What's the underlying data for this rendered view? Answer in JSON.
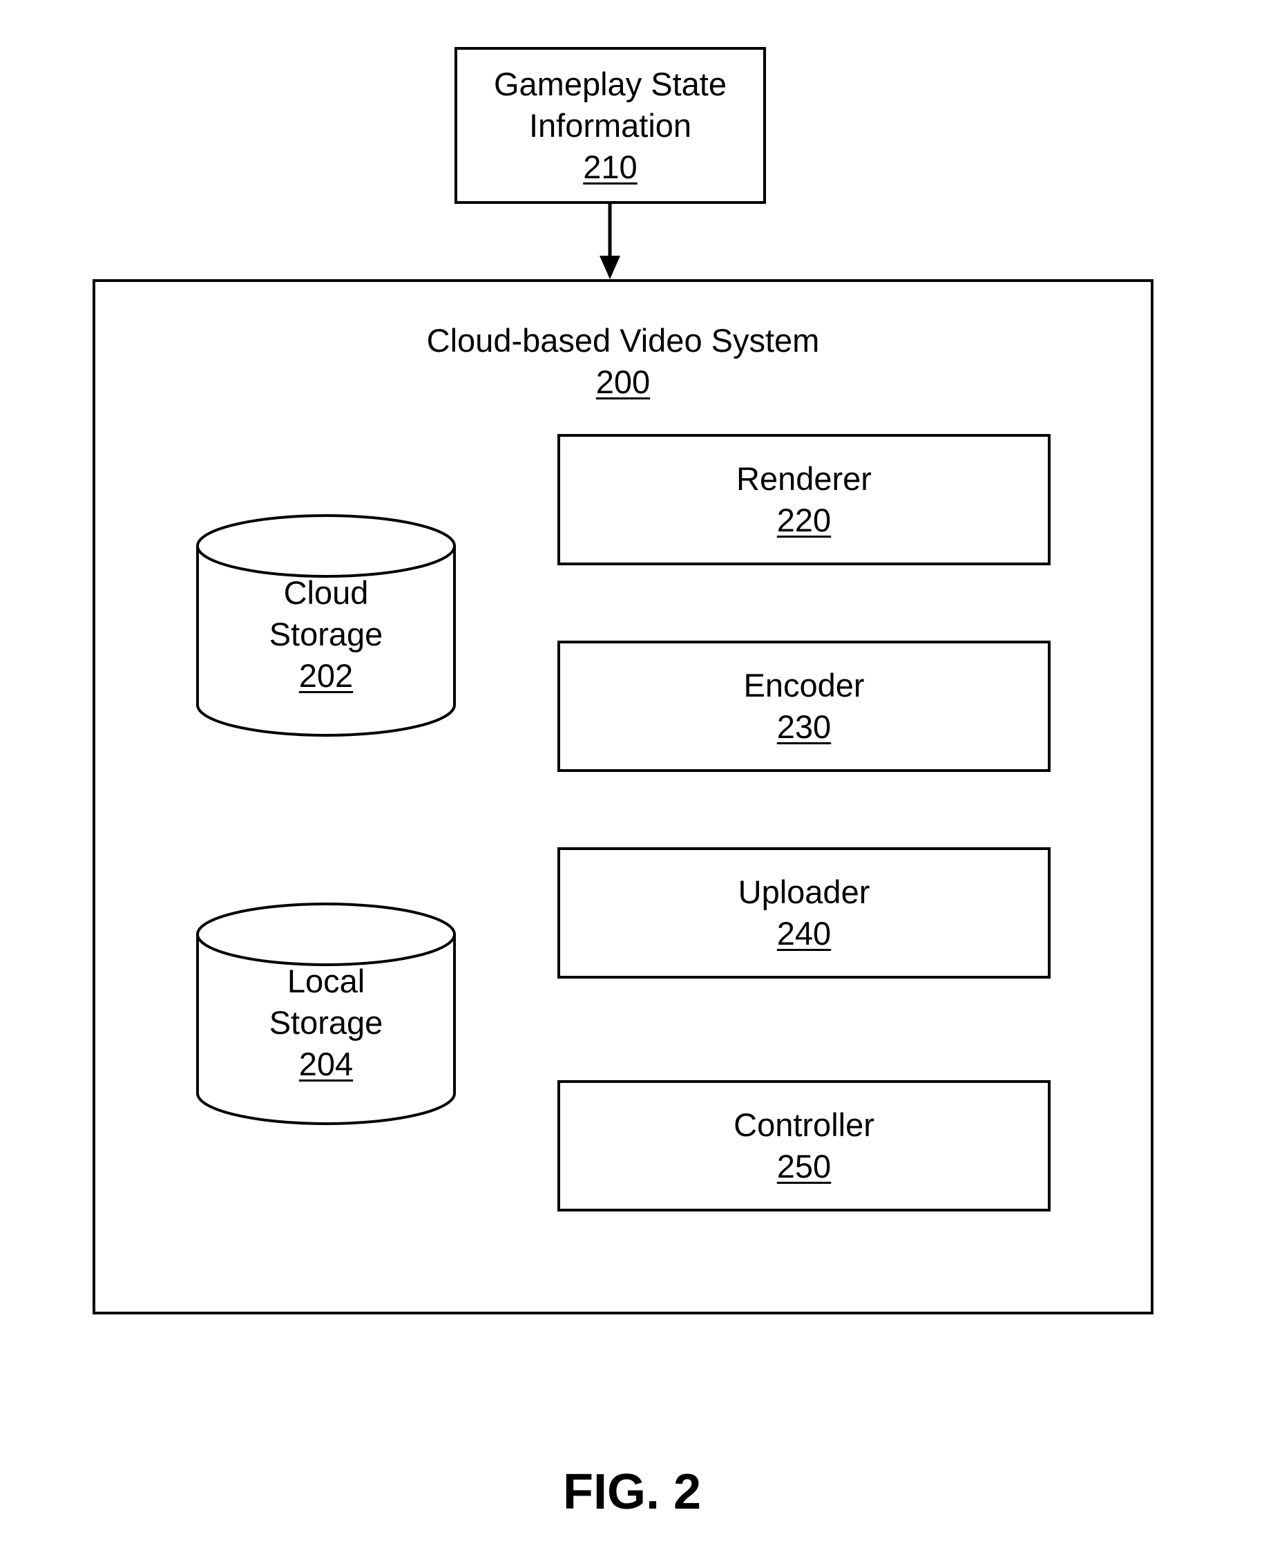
{
  "figure_label": "FIG. 2",
  "input": {
    "title_line1": "Gameplay State",
    "title_line2": "Information",
    "ref": "210"
  },
  "system": {
    "title": "Cloud-based Video System",
    "ref": "200"
  },
  "storages": [
    {
      "line1": "Cloud",
      "line2": "Storage",
      "ref": "202"
    },
    {
      "line1": "Local",
      "line2": "Storage",
      "ref": "204"
    }
  ],
  "components": [
    {
      "label": "Renderer",
      "ref": "220"
    },
    {
      "label": "Encoder",
      "ref": "230"
    },
    {
      "label": "Uploader",
      "ref": "240"
    },
    {
      "label": "Controller",
      "ref": "250"
    }
  ],
  "arrows": [
    {
      "from": "210",
      "to": "200"
    }
  ]
}
